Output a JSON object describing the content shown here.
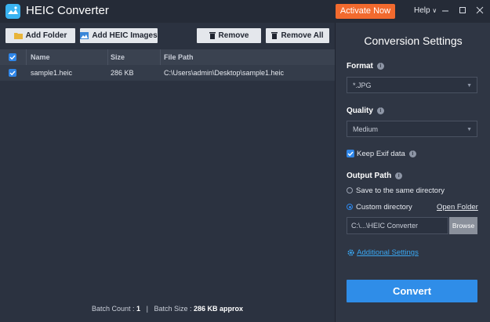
{
  "app": {
    "title": "HEIC Converter",
    "logo_text": "HEIC"
  },
  "titlebar": {
    "activate_label": "Activate Now",
    "help_label": "Help"
  },
  "toolbar": {
    "add_folder_label": "Add Folder",
    "add_images_label": "Add HEIC Images",
    "remove_label": "Remove",
    "remove_all_label": "Remove All"
  },
  "table": {
    "columns": [
      "Name",
      "Size",
      "File Path"
    ],
    "rows": [
      {
        "name": "sample1.heic",
        "size": "286 KB",
        "path": "C:\\Users\\admin\\Desktop\\sample1.heic",
        "checked": true
      }
    ]
  },
  "footer": {
    "batch_count_label": "Batch Count :",
    "batch_count_value": "1",
    "separator": "|",
    "batch_size_label": "Batch Size :",
    "batch_size_value": "286 KB approx"
  },
  "settings": {
    "title": "Conversion Settings",
    "format_label": "Format",
    "format_value": "*.JPG",
    "quality_label": "Quality",
    "quality_value": "Medium",
    "keep_exif_label": "Keep Exif data",
    "keep_exif_checked": true,
    "output_path_label": "Output Path",
    "same_dir_label": "Save to the same directory",
    "custom_dir_label": "Custom directory",
    "open_folder_label": "Open Folder",
    "path_value": "C:\\...\\HEIC Converter",
    "browse_label": "Browse",
    "additional_settings_label": "Additional Settings",
    "convert_label": "Convert"
  },
  "colors": {
    "accent": "#2f8de8",
    "activate": "#f26a2e",
    "link": "#3aa6f0"
  }
}
